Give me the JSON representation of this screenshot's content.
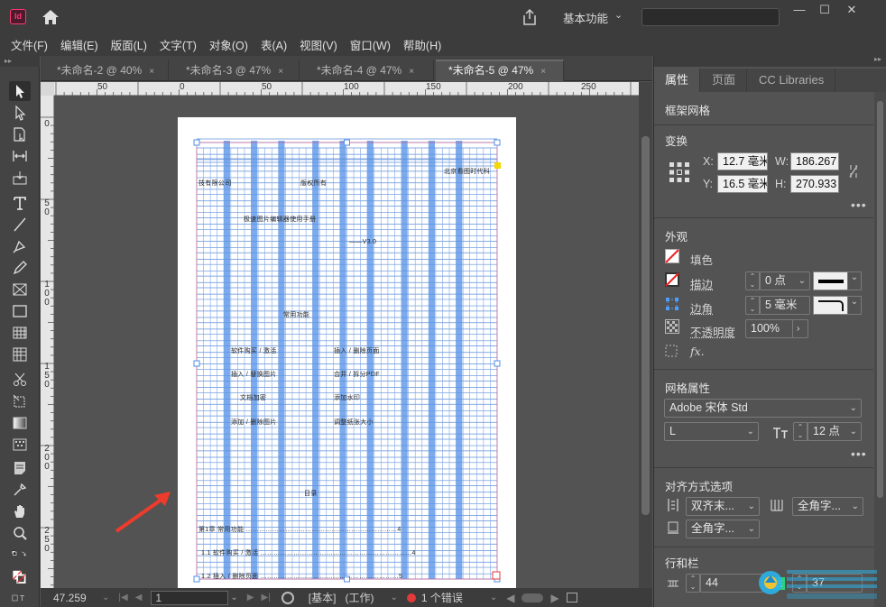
{
  "titlebar": {
    "app_logo": "Id",
    "workspace": "基本功能",
    "window_buttons": [
      "—",
      "☐",
      "✕"
    ]
  },
  "menu": [
    "文件(F)",
    "编辑(E)",
    "版面(L)",
    "文字(T)",
    "对象(O)",
    "表(A)",
    "视图(V)",
    "窗口(W)",
    "帮助(H)"
  ],
  "tabs": [
    {
      "label": "*未命名-2 @ 40%",
      "close": "×"
    },
    {
      "label": "*未命名-3 @ 47%",
      "close": "×"
    },
    {
      "label": "*未命名-4 @ 47%",
      "close": "×"
    },
    {
      "label": "*未命名-5 @ 47%",
      "close": "×"
    }
  ],
  "hruler": [
    "50",
    "0",
    "50",
    "100",
    "150",
    "200",
    "250"
  ],
  "vruler": [
    [
      "0"
    ],
    [
      "5",
      "0"
    ],
    [
      "1",
      "0",
      "0"
    ],
    [
      "1",
      "5",
      "0"
    ],
    [
      "2",
      "0",
      "0"
    ],
    [
      "2",
      "5",
      "0"
    ]
  ],
  "document": {
    "lines": [
      "北京看图时代科",
      "技有限公司",
      "版权所有",
      "极速图片编辑器使用手册",
      "——V3.0",
      "常用功能",
      "软件购买 / 激活",
      "插入 / 删除页面",
      "插入 / 替换图片",
      "合并 / 拆分PDF",
      "文档加密",
      "添加水印",
      "添加 / 删除图片",
      "调整纸张大小",
      "目录",
      "第1章 常用功能 ……………………………………………………………4",
      "1.1 软件购买 / 激活 ……………………………………………………………4",
      "1.2 插入 / 删除页面 ………………………………………………………5"
    ]
  },
  "status": {
    "zoom": "47.259",
    "page": "1",
    "mode": "[基本]",
    "state": "(工作)",
    "errors": "1 个错误",
    "error_color": "#e23a3a"
  },
  "panel": {
    "tabs": [
      "属性",
      "页面",
      "CC Libraries"
    ],
    "object_type": "框架网格",
    "transform": {
      "title": "变换",
      "x_label": "X:",
      "x": "12.7 毫米",
      "y_label": "Y:",
      "y": "16.5 毫米",
      "w_label": "W:",
      "w": "186.267",
      "h_label": "H:",
      "h": "270.933"
    },
    "appearance": {
      "title": "外观",
      "fill": "填色",
      "stroke": "描边",
      "stroke_value": "0 点",
      "corner": "边角",
      "corner_value": "5 毫米",
      "opacity": "不透明度",
      "opacity_value": "100%",
      "fx": "fx."
    },
    "grid": {
      "title": "网格属性",
      "font": "Adobe 宋体 Std",
      "style": "L",
      "size": "12 点"
    },
    "align": {
      "title": "对齐方式选项",
      "justify": "双齐末...",
      "char1": "全角字...",
      "char2": "全角字..."
    },
    "rows": {
      "title": "行和栏",
      "v1": "44",
      "v2": "37"
    }
  }
}
